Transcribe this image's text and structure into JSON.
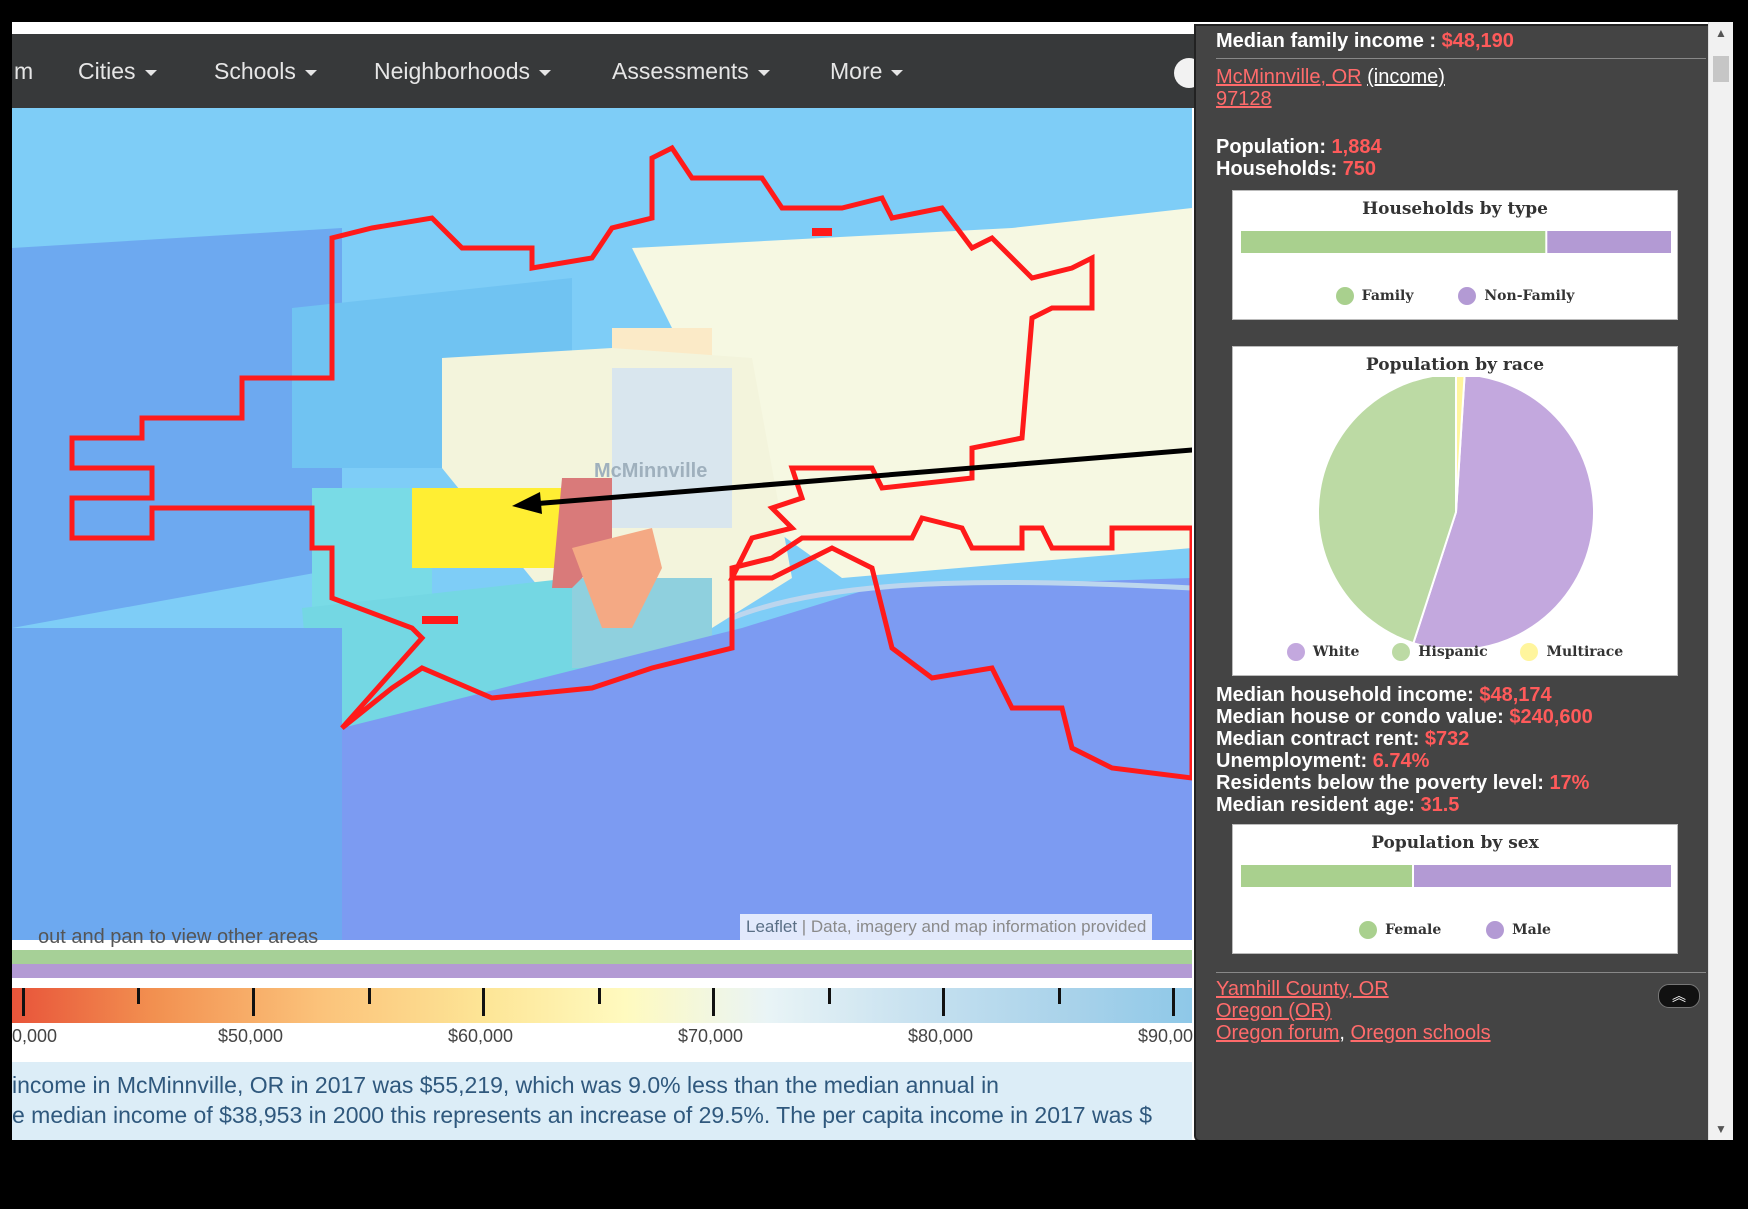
{
  "nav": {
    "partial_left": "m",
    "items": [
      "Cities",
      "Schools",
      "Neighborhoods",
      "Assessments",
      "More"
    ]
  },
  "map": {
    "town_label": "McMinnville",
    "attribution_leaflet": "Leaflet",
    "attribution_text": " | Data, imagery and map information provided",
    "zoom_hint": "out and pan to view other areas"
  },
  "legend": {
    "labels": [
      "0,000",
      "$50,000",
      "$60,000",
      "$70,000",
      "$80,000",
      "$90,00"
    ]
  },
  "description": {
    "line1": "income in McMinnville, OR in 2017 was $55,219, which was 9.0% less than the median annual in",
    "line2": "e median income of $38,953 in 2000 this represents an increase of 29.5%. The per capita income in 2017 was $"
  },
  "panel": {
    "median_family_label": "Median family income : ",
    "median_family_value": "$48,190",
    "place_link": "McMinnville, OR",
    "income_link": "(income)",
    "zip_link": "97128",
    "population_label": "Population: ",
    "population_value": "1,884",
    "households_label": "Households: ",
    "households_value": "750",
    "households_chart": {
      "title": "Households by type",
      "legend": [
        "Family",
        "Non-Family"
      ]
    },
    "race_chart": {
      "title": "Population by race",
      "legend": [
        "White",
        "Hispanic",
        "Multirace"
      ]
    },
    "stats": [
      {
        "label": "Median household income: ",
        "value": "$48,174"
      },
      {
        "label": "Median house or condo value: ",
        "value": "$240,600"
      },
      {
        "label": "Median contract rent: ",
        "value": "$732"
      },
      {
        "label": "Unemployment: ",
        "value": "6.74%"
      },
      {
        "label": "Residents below the poverty level: ",
        "value": "17%"
      },
      {
        "label": "Median resident age: ",
        "value": "31.5"
      }
    ],
    "sex_chart": {
      "title": "Population by sex",
      "legend": [
        "Female",
        "Male"
      ]
    },
    "footer_links": {
      "county": "Yamhill County, OR",
      "state": "Oregon (OR)",
      "forum": "Oregon forum",
      "separator": ", ",
      "schools": "Oregon schools"
    },
    "collapse_glyph": "︽"
  },
  "colors": {
    "value_red": "#ff5a5a",
    "family_green": "#a9d08e",
    "nonfamily_purple": "#b39ad4",
    "multirace_yellow": "#fff59d"
  },
  "chart_data": [
    {
      "type": "bar",
      "title": "Households by type",
      "categories": [
        "Family",
        "Non-Family"
      ],
      "values": [
        71,
        29
      ]
    },
    {
      "type": "pie",
      "title": "Population by race",
      "categories": [
        "White",
        "Hispanic",
        "Multirace"
      ],
      "values": [
        54,
        45,
        1
      ]
    },
    {
      "type": "bar",
      "title": "Population by sex",
      "categories": [
        "Female",
        "Male"
      ],
      "values": [
        40,
        60
      ]
    }
  ]
}
